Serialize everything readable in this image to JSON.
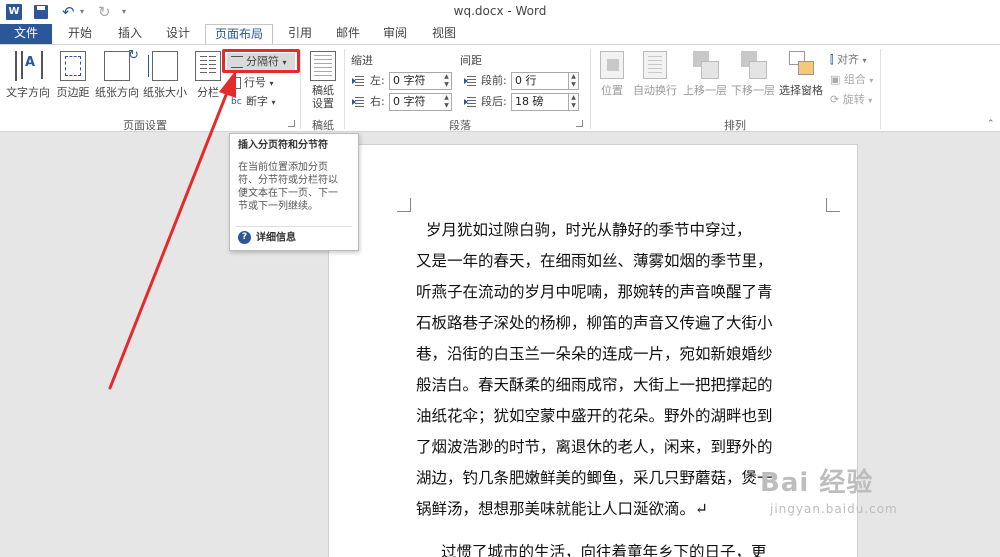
{
  "window": {
    "title": "wq.docx - Word"
  },
  "quick_access": {
    "app_icon": "word-logo",
    "app_letter": "W"
  },
  "tabs": [
    "文件",
    "开始",
    "插入",
    "设计",
    "页面布局",
    "引用",
    "邮件",
    "审阅",
    "视图"
  ],
  "active_tab": "页面布局",
  "ribbon": {
    "page_setup": {
      "label": "页面设置",
      "text_direction": "文字方向",
      "margins": "页边距",
      "orientation": "纸张方向",
      "size": "纸张大小",
      "columns": "分栏",
      "breaks": "分隔符",
      "line_numbers": "行号",
      "hyphenation": "断字"
    },
    "manuscript": {
      "label": "稿纸",
      "button_line1": "稿纸",
      "button_line2": "设置"
    },
    "paragraph": {
      "label": "段落",
      "indent_head": "缩进",
      "spacing_head": "间距",
      "indent_left_label": "左:",
      "indent_left_value": "0 字符",
      "indent_right_label": "右:",
      "indent_right_value": "0 字符",
      "spacing_before_label": "段前:",
      "spacing_before_value": "0 行",
      "spacing_after_label": "段后:",
      "spacing_after_value": "18 磅"
    },
    "arrange": {
      "label": "排列",
      "position": "位置",
      "wrap_text": "自动换行",
      "bring_forward": "上移一层",
      "send_backward": "下移一层",
      "selection_pane": "选择窗格",
      "align": "对齐",
      "group": "组合",
      "rotate": "旋转"
    }
  },
  "tooltip": {
    "title": "插入分页符和分节符",
    "body_lines": [
      "在当前位置添加分页",
      "符、分节符或分栏符以",
      "便文本在下一页、下一",
      "节或下一列继续。"
    ],
    "more_info": "详细信息"
  },
  "document": {
    "lines": [
      "岁月犹如过隙白驹，时光从静好的季节中穿过，",
      "又是一年的春天，在细雨如丝、薄雾如烟的季节里，",
      "听燕子在流动的岁月中呢喃，那婉转的声音唤醒了青",
      "石板路巷子深处的杨柳，柳笛的声音又传遍了大街小",
      "巷，沿街的白玉兰一朵朵的连成一片，宛如新娘婚纱",
      "般洁白。春天酥柔的细雨成帘，大街上一把把撑起的",
      "油纸花伞；犹如空蒙中盛开的花朵。野外的湖畔也到",
      "了烟波浩渺的时节，离退休的老人，闲来，到野外的",
      "湖边，钓几条肥嫩鲜美的鲫鱼，采几只野蘑菇，煲一",
      "锅鲜汤，想想那美味就能让人口涎欲滴。↵"
    ],
    "next_paragraph_start": "过惯了城市的生活，向往着童年乡下的日子，更"
  },
  "watermark": {
    "logo": "Bai 经验",
    "url": "jingyan.baidu.com"
  },
  "colors": {
    "word_blue": "#2b579a",
    "highlight_red": "#e32b2b"
  }
}
